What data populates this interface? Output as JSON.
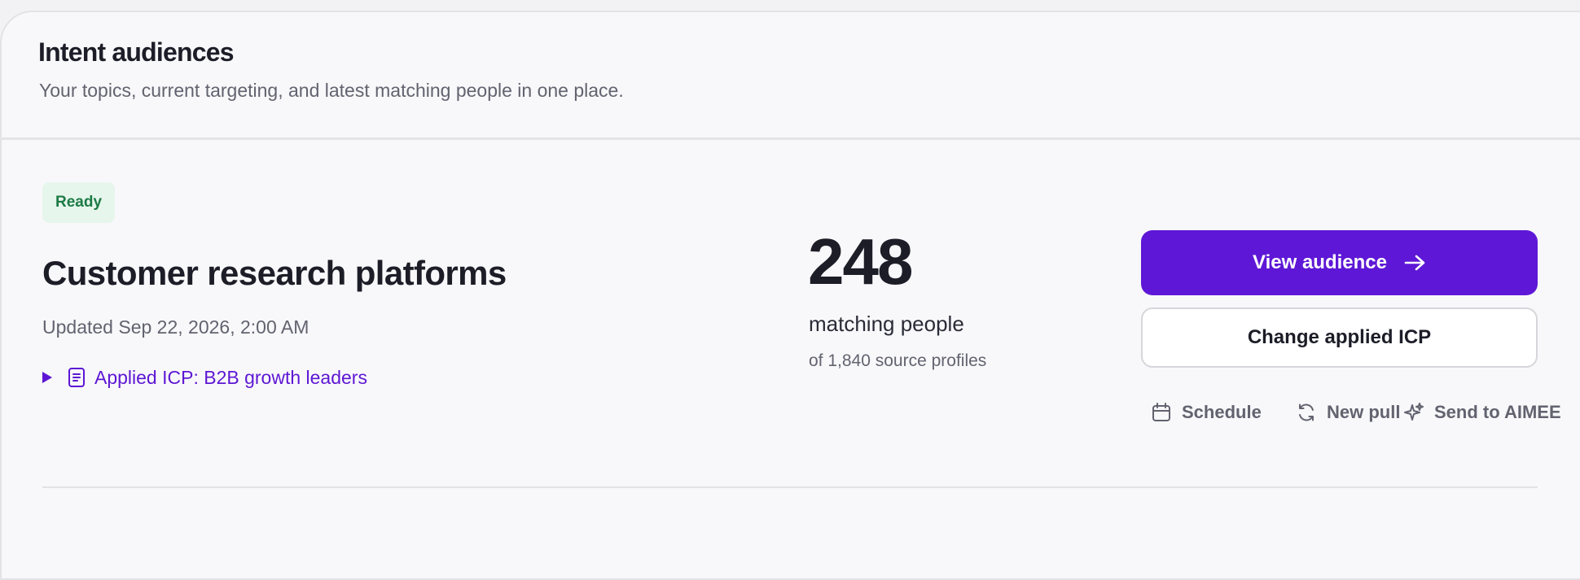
{
  "header": {
    "title": "Intent audiences",
    "subtitle": "Your topics, current targeting, and latest matching people in one place."
  },
  "audience": {
    "status": "Ready",
    "name": "Customer research platforms",
    "updated": "Updated Sep 22, 2026, 2:00 AM",
    "icp_link": "Applied ICP: B2B growth leaders",
    "match_count": "248",
    "match_label": "matching people",
    "source_text": "of 1,840 source profiles"
  },
  "actions": {
    "view_audience": "View audience",
    "change_icp": "Change applied ICP",
    "schedule": "Schedule",
    "new_pull": "New pull",
    "send_to_aimee": "Send to AIMEE"
  },
  "icons": {
    "icp_disclosure": "triangle-right-icon",
    "icp_document": "document-icon",
    "view_arrow": "arrow-right-icon",
    "schedule": "calendar-icon",
    "new_pull": "refresh-icon",
    "send": "sparkles-icon"
  },
  "colors": {
    "primary": "#5e17d6",
    "ready_badge_bg": "#e6f6ec",
    "ready_badge_text": "#1c7a45",
    "muted_text": "#62636f"
  }
}
